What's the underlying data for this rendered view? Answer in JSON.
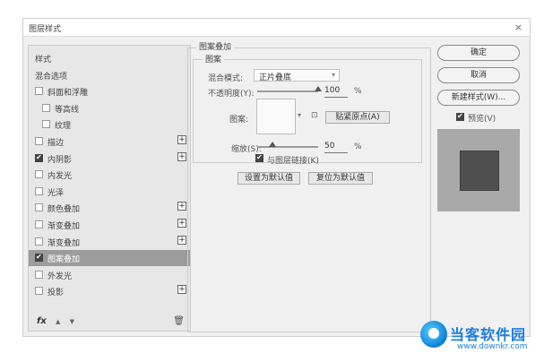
{
  "dialog": {
    "title": "图层样式",
    "close": "×"
  },
  "left_panel": {
    "items": [
      {
        "label": "样式",
        "checkbox": false,
        "checked": false,
        "plus": false,
        "indent": 0
      },
      {
        "label": "混合选项",
        "checkbox": false,
        "checked": false,
        "plus": false,
        "indent": 0
      },
      {
        "label": "斜面和浮雕",
        "checkbox": true,
        "checked": false,
        "plus": false,
        "indent": 0
      },
      {
        "label": "等高线",
        "checkbox": true,
        "checked": false,
        "plus": false,
        "indent": 1
      },
      {
        "label": "纹理",
        "checkbox": true,
        "checked": false,
        "plus": false,
        "indent": 1
      },
      {
        "label": "描边",
        "checkbox": true,
        "checked": false,
        "plus": true,
        "indent": 0
      },
      {
        "label": "内阴影",
        "checkbox": true,
        "checked": true,
        "plus": true,
        "indent": 0
      },
      {
        "label": "内发光",
        "checkbox": true,
        "checked": false,
        "plus": false,
        "indent": 0
      },
      {
        "label": "光泽",
        "checkbox": true,
        "checked": false,
        "plus": false,
        "indent": 0
      },
      {
        "label": "颜色叠加",
        "checkbox": true,
        "checked": false,
        "plus": true,
        "indent": 0
      },
      {
        "label": "渐变叠加",
        "checkbox": true,
        "checked": false,
        "plus": true,
        "indent": 0
      },
      {
        "label": "渐变叠加",
        "checkbox": true,
        "checked": false,
        "plus": true,
        "indent": 0
      },
      {
        "label": "图案叠加",
        "checkbox": true,
        "checked": true,
        "plus": false,
        "indent": 0,
        "selected": true
      },
      {
        "label": "外发光",
        "checkbox": true,
        "checked": false,
        "plus": false,
        "indent": 0
      },
      {
        "label": "投影",
        "checkbox": true,
        "checked": false,
        "plus": true,
        "indent": 0
      }
    ],
    "plus_symbol": "+",
    "footer": {
      "fx": "fx",
      "up": "▲",
      "down": "▼",
      "trash": "🗑"
    }
  },
  "pattern_overlay": {
    "group_title": "图案叠加",
    "sub_title": "图案",
    "blend_label": "混合模式:",
    "blend_value": "正片叠底",
    "opacity_label": "不透明度(Y):",
    "opacity_value": "100",
    "opacity_unit": "%",
    "opacity_fraction": 1.0,
    "pattern_label": "图案:",
    "snap_button": "贴紧原点(A)",
    "scale_label": "缩放(S):",
    "scale_value": "50",
    "scale_unit": "%",
    "scale_fraction": 0.25,
    "link_label": "与图层链接(K)",
    "set_default_button": "设置为默认值",
    "reset_default_button": "复位为默认值"
  },
  "right_panel": {
    "ok_button": "确定",
    "cancel_button": "取消",
    "new_style_button": "新建样式(W)...",
    "preview_label": "预览(V)",
    "preview_checked": true
  },
  "watermark": {
    "brand": "当客软件园",
    "url": "www.downkr.com"
  },
  "colors": {
    "selected_row": "#9c9c9c",
    "preview_bg": "#a9a9a9",
    "preview_swatch": "#4f4f4f",
    "watermark_blue": "#1b7fe0"
  }
}
